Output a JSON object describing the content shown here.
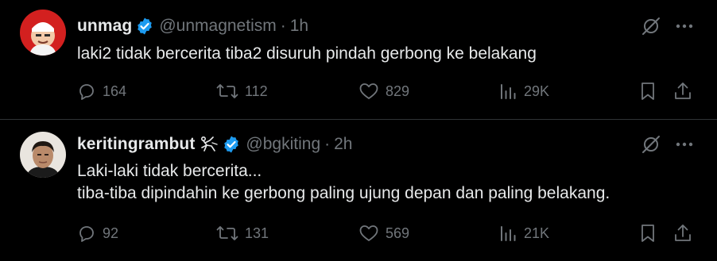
{
  "tweets": [
    {
      "display_name": "unmag",
      "handle": "@unmagnetism",
      "separator": "·",
      "time": "1h",
      "lines": [
        "laki2 tidak bercerita tiba2 disuruh pindah gerbong ke belakang"
      ],
      "stats": {
        "replies": "164",
        "retweets": "112",
        "likes": "829",
        "views": "29K"
      }
    },
    {
      "display_name": "keritingrambut",
      "handle": "@bgkiting",
      "separator": "·",
      "time": "2h",
      "lines": [
        "Laki-laki tidak bercerita...",
        "tiba-tiba dipindahin ke gerbong paling ujung depan dan paling belakang."
      ],
      "stats": {
        "replies": "92",
        "retweets": "131",
        "likes": "569",
        "views": "21K"
      }
    }
  ],
  "colors": {
    "background": "#000000",
    "primary_text": "#e7e9ea",
    "secondary_text": "#71767b",
    "verified_badge": "#1d9bf0",
    "divider": "#2f3336"
  },
  "icons": [
    "grok-icon",
    "more-icon",
    "reply-icon",
    "retweet-icon",
    "like-icon",
    "views-icon",
    "bookmark-icon",
    "share-icon",
    "verified-badge-icon"
  ]
}
